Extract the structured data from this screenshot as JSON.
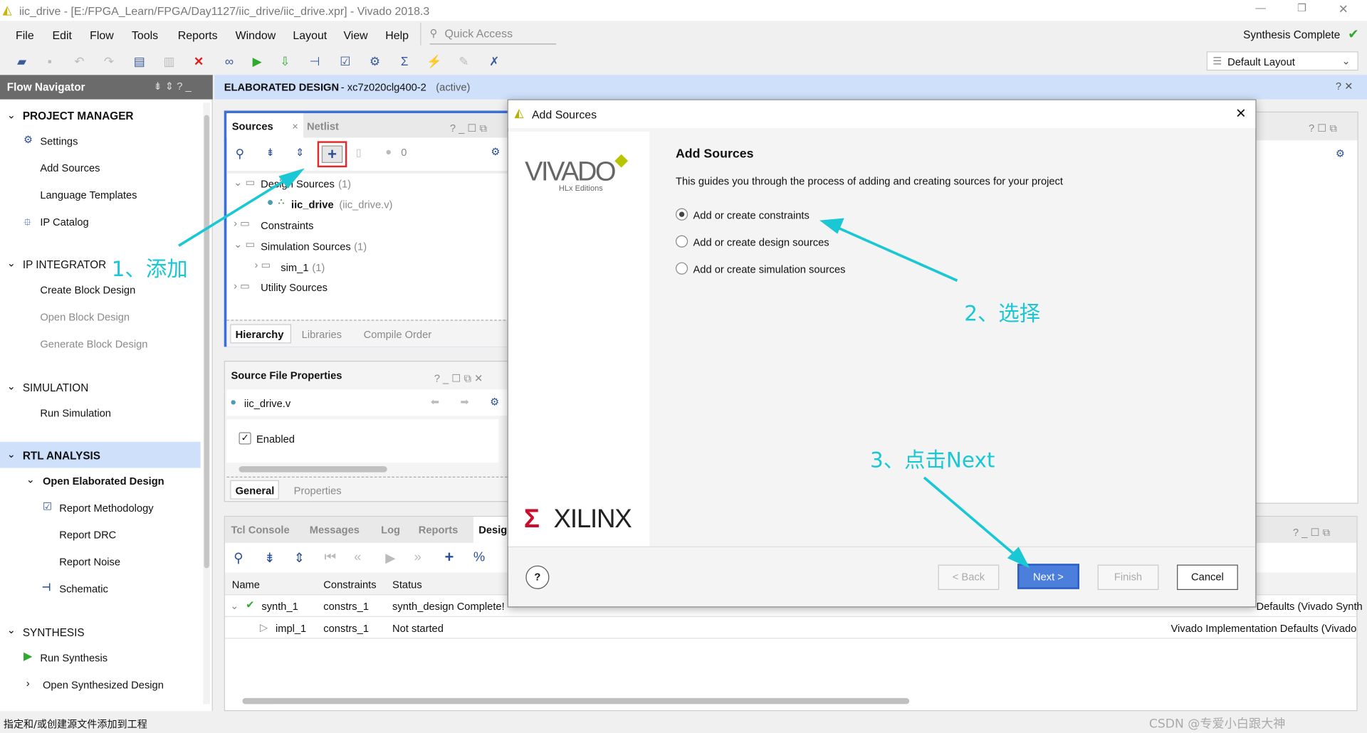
{
  "window": {
    "title": "iic_drive - [E:/FPGA_Learn/FPGA/Day1127/iic_drive/iic_drive.xpr] - Vivado 2018.3",
    "status_right": "Synthesis Complete"
  },
  "menu": [
    "File",
    "Edit",
    "Flow",
    "Tools",
    "Reports",
    "Window",
    "Layout",
    "View",
    "Help"
  ],
  "quick_access": {
    "placeholder": "Quick Access"
  },
  "layout_select": "Default Layout",
  "flow_nav": {
    "title": "Flow Navigator",
    "project_manager": "PROJECT MANAGER",
    "pm_items": [
      "Settings",
      "Add Sources",
      "Language Templates",
      "IP Catalog"
    ],
    "ip_integrator": "IP INTEGRATOR",
    "ipi_items": [
      "Create Block Design",
      "Open Block Design",
      "Generate Block Design"
    ],
    "simulation": "SIMULATION",
    "sim_items": [
      "Run Simulation"
    ],
    "rtl": "RTL ANALYSIS",
    "rtl_sub": "Open Elaborated Design",
    "rtl_items": [
      "Report Methodology",
      "Report DRC",
      "Report Noise",
      "Schematic"
    ],
    "synthesis": "SYNTHESIS",
    "syn_items": [
      "Run Synthesis",
      "Open Synthesized Design"
    ]
  },
  "header": {
    "title": "ELABORATED DESIGN",
    "part": "- xc7z020clg400-2",
    "state": "(active)"
  },
  "sources": {
    "tabs": [
      "Sources",
      "Netlist"
    ],
    "count": "0",
    "tree": [
      {
        "label": "Design Sources",
        "count": "(1)"
      },
      {
        "label": "iic_drive",
        "file": "(iic_drive.v)"
      },
      {
        "label": "Constraints"
      },
      {
        "label": "Simulation Sources",
        "count": "(1)"
      },
      {
        "label": "sim_1",
        "count": "(1)"
      },
      {
        "label": "Utility Sources"
      }
    ],
    "bottom_tabs": [
      "Hierarchy",
      "Libraries",
      "Compile Order"
    ]
  },
  "props": {
    "title": "Source File Properties",
    "file": "iic_drive.v",
    "enabled": "Enabled",
    "enabled_checked": true,
    "tabs": [
      "General",
      "Properties"
    ]
  },
  "bottom": {
    "tabs": [
      "Tcl Console",
      "Messages",
      "Log",
      "Reports",
      "Desig"
    ],
    "columns": [
      "Name",
      "Constraints",
      "Status"
    ],
    "rows": [
      {
        "name": "synth_1",
        "constraints": "constrs_1",
        "status": "synth_design Complete!",
        "strategy": "Defaults (Vivado Synth"
      },
      {
        "name": "impl_1",
        "constraints": "constrs_1",
        "status": "Not started",
        "strategy": "Vivado Implementation Defaults (Vivado"
      }
    ]
  },
  "dialog": {
    "title": "Add Sources",
    "heading": "Add Sources",
    "desc": "This guides you through the process of adding and creating sources for your project",
    "options": [
      "Add or create constraints",
      "Add or create design sources",
      "Add or create simulation sources"
    ],
    "selected": 0,
    "logo": "VIVADO",
    "logo_sub": "HLx Editions",
    "brand": "XILINX",
    "buttons": {
      "help": "?",
      "back": "< Back",
      "next": "Next >",
      "finish": "Finish",
      "cancel": "Cancel"
    }
  },
  "annotations": [
    "1、添加",
    "2、选择",
    "3、点击Next"
  ],
  "statusbar": "指定和/或创建源文件添加到工程",
  "watermark": "CSDN @专爱小白跟大神",
  "colors": {
    "accent": "#3d6fd8",
    "annotation": "#19c8d4",
    "highlight": "#e8262a",
    "nav_selected": "#cfe0fa"
  }
}
